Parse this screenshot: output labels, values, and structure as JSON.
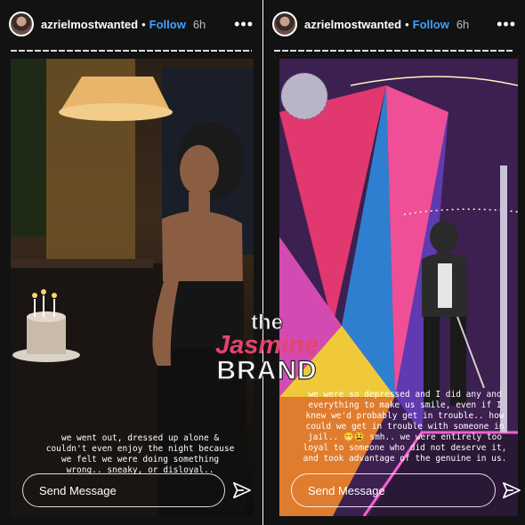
{
  "stories": [
    {
      "username": "azrielmostwanted",
      "separator": "•",
      "follow_label": "Follow",
      "time": "6h",
      "more_icon": "more-options-icon",
      "caption_lines": [
        "we went out, dressed up alone &",
        "couldn't even enjoy the night because",
        "we felt we were doing something",
        "wrong.. sneaky, or disloyal.."
      ],
      "send_placeholder": "Send Message",
      "send_icon": "paper-plane-icon"
    },
    {
      "username": "azrielmostwanted",
      "separator": "•",
      "follow_label": "Follow",
      "time": "6h",
      "more_icon": "more-options-icon",
      "caption_lines": [
        "we were so depressed and I did any and",
        "everything to make us smile, even if I",
        "knew we'd probably get in trouble.. how",
        "could we get in trouble with someone in",
        "jail.. 😬😫 smh.. we were entirely too",
        "loyal to someone who did not deserve it,",
        "and took advantage of the genuine in us."
      ],
      "send_placeholder": "Send Message",
      "send_icon": "paper-plane-icon"
    }
  ],
  "watermark": {
    "line1": "the",
    "line2": "Jasmine",
    "line3": "BRAND"
  },
  "colors": {
    "follow": "#3ea2ff",
    "watermark_pink": "#e2456e",
    "story_bg": "#121212"
  }
}
